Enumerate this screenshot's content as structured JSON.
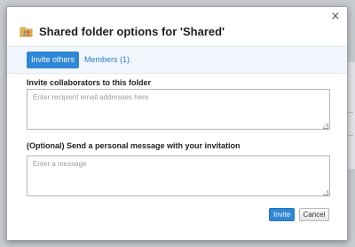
{
  "dialog": {
    "title": "Shared folder options for 'Shared'",
    "close_label": "×",
    "icon": "shared-folder-icon"
  },
  "tabs": [
    {
      "label": "Invite others",
      "active": true
    },
    {
      "label": "Members (1)",
      "active": false
    }
  ],
  "invite": {
    "collaborators_label": "Invite collaborators to this folder",
    "collaborators_placeholder": "Enter recipient email addresses here",
    "collaborators_value": "",
    "message_label": "(Optional) Send a personal message with your invitation",
    "message_placeholder": "Enter a message",
    "message_value": ""
  },
  "buttons": {
    "invite_label": "Invite",
    "cancel_label": "Cancel"
  },
  "colors": {
    "accent": "#2f87d6",
    "tab_bar": "#f0f6fb",
    "link": "#2f7dc4"
  }
}
